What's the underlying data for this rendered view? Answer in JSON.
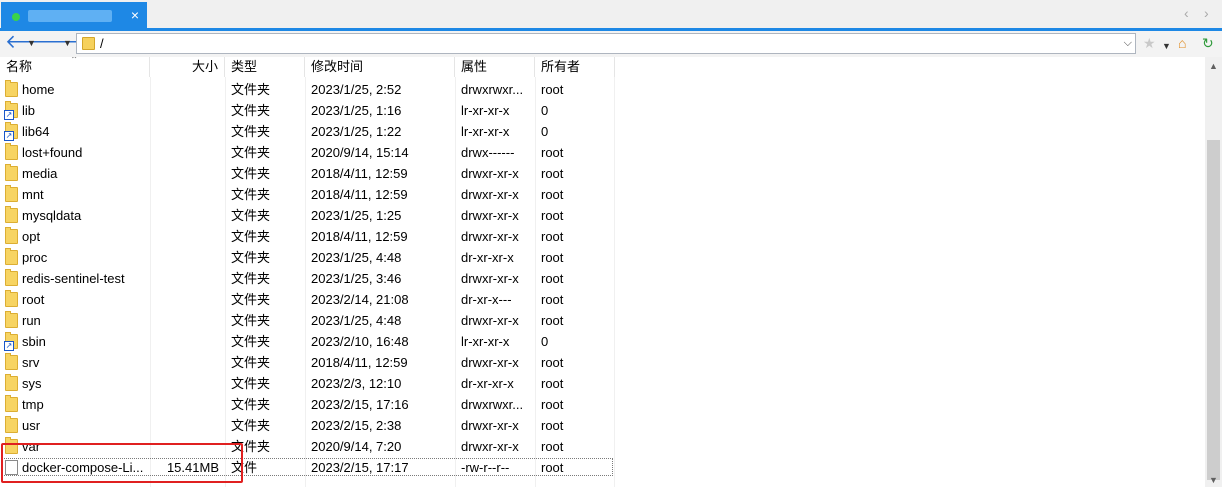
{
  "toolbar": {
    "path": "/",
    "icons": {
      "back": "back-arrow-icon",
      "forward": "forward-arrow-icon",
      "favorite": "star-icon",
      "home": "home-icon",
      "refresh": "refresh-icon"
    }
  },
  "tab": {
    "close_glyph": "×"
  },
  "columns": {
    "name": "名称",
    "size": "大小",
    "type": "类型",
    "modified": "修改时间",
    "attrs": "属性",
    "owner": "所有者"
  },
  "files": [
    {
      "name": "home",
      "size": "",
      "type": "文件夹",
      "modified": "2023/1/25, 2:52",
      "attrs": "drwxrwxr...",
      "owner": "root",
      "kind": "folder"
    },
    {
      "name": "lib",
      "size": "",
      "type": "文件夹",
      "modified": "2023/1/25, 1:16",
      "attrs": "lr-xr-xr-x",
      "owner": "0",
      "kind": "link"
    },
    {
      "name": "lib64",
      "size": "",
      "type": "文件夹",
      "modified": "2023/1/25, 1:22",
      "attrs": "lr-xr-xr-x",
      "owner": "0",
      "kind": "link"
    },
    {
      "name": "lost+found",
      "size": "",
      "type": "文件夹",
      "modified": "2020/9/14, 15:14",
      "attrs": "drwx------",
      "owner": "root",
      "kind": "folder"
    },
    {
      "name": "media",
      "size": "",
      "type": "文件夹",
      "modified": "2018/4/11, 12:59",
      "attrs": "drwxr-xr-x",
      "owner": "root",
      "kind": "folder"
    },
    {
      "name": "mnt",
      "size": "",
      "type": "文件夹",
      "modified": "2018/4/11, 12:59",
      "attrs": "drwxr-xr-x",
      "owner": "root",
      "kind": "folder"
    },
    {
      "name": "mysqldata",
      "size": "",
      "type": "文件夹",
      "modified": "2023/1/25, 1:25",
      "attrs": "drwxr-xr-x",
      "owner": "root",
      "kind": "folder"
    },
    {
      "name": "opt",
      "size": "",
      "type": "文件夹",
      "modified": "2018/4/11, 12:59",
      "attrs": "drwxr-xr-x",
      "owner": "root",
      "kind": "folder"
    },
    {
      "name": "proc",
      "size": "",
      "type": "文件夹",
      "modified": "2023/1/25, 4:48",
      "attrs": "dr-xr-xr-x",
      "owner": "root",
      "kind": "folder"
    },
    {
      "name": "redis-sentinel-test",
      "size": "",
      "type": "文件夹",
      "modified": "2023/1/25, 3:46",
      "attrs": "drwxr-xr-x",
      "owner": "root",
      "kind": "folder"
    },
    {
      "name": "root",
      "size": "",
      "type": "文件夹",
      "modified": "2023/2/14, 21:08",
      "attrs": "dr-xr-x---",
      "owner": "root",
      "kind": "folder"
    },
    {
      "name": "run",
      "size": "",
      "type": "文件夹",
      "modified": "2023/1/25, 4:48",
      "attrs": "drwxr-xr-x",
      "owner": "root",
      "kind": "folder"
    },
    {
      "name": "sbin",
      "size": "",
      "type": "文件夹",
      "modified": "2023/2/10, 16:48",
      "attrs": "lr-xr-xr-x",
      "owner": "0",
      "kind": "link"
    },
    {
      "name": "srv",
      "size": "",
      "type": "文件夹",
      "modified": "2018/4/11, 12:59",
      "attrs": "drwxr-xr-x",
      "owner": "root",
      "kind": "folder"
    },
    {
      "name": "sys",
      "size": "",
      "type": "文件夹",
      "modified": "2023/2/3, 12:10",
      "attrs": "dr-xr-xr-x",
      "owner": "root",
      "kind": "folder"
    },
    {
      "name": "tmp",
      "size": "",
      "type": "文件夹",
      "modified": "2023/2/15, 17:16",
      "attrs": "drwxrwxr...",
      "owner": "root",
      "kind": "folder"
    },
    {
      "name": "usr",
      "size": "",
      "type": "文件夹",
      "modified": "2023/2/15, 2:38",
      "attrs": "drwxr-xr-x",
      "owner": "root",
      "kind": "folder"
    },
    {
      "name": "var",
      "size": "",
      "type": "文件夹",
      "modified": "2020/9/14, 7:20",
      "attrs": "drwxr-xr-x",
      "owner": "root",
      "kind": "folder"
    },
    {
      "name": "docker-compose-Li...",
      "size": "15.41MB",
      "type": "文件",
      "modified": "2023/2/15, 17:17",
      "attrs": "-rw-r--r--",
      "owner": "root",
      "kind": "file",
      "selected": true
    }
  ],
  "colors": {
    "accent": "#1e88e5",
    "highlight_box": "#e02020",
    "folder": "#f7d462"
  }
}
